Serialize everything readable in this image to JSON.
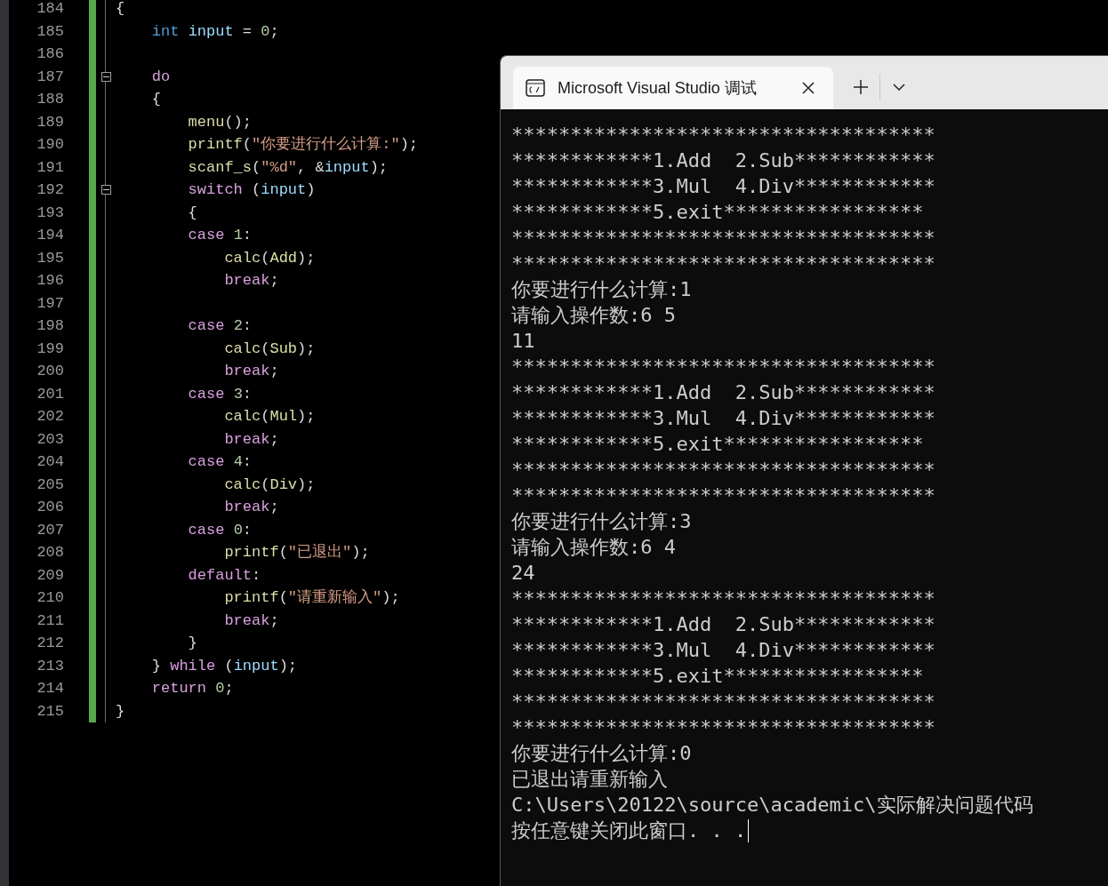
{
  "editor": {
    "lines": [
      {
        "number": "184",
        "tokens": [
          {
            "text": "{",
            "kind": "plain"
          }
        ]
      },
      {
        "number": "185",
        "tokens": [
          {
            "text": "    int ",
            "kind": "type"
          },
          {
            "text": "input",
            "kind": "var"
          },
          {
            "text": " = ",
            "kind": "plain"
          },
          {
            "text": "0",
            "kind": "number"
          },
          {
            "text": ";",
            "kind": "plain"
          }
        ]
      },
      {
        "number": "186"
      },
      {
        "number": "187",
        "fold": {
          "expanded": true
        },
        "tokens": [
          {
            "text": "    do",
            "kind": "keyword"
          }
        ]
      },
      {
        "number": "188",
        "tokens": [
          {
            "text": "    {",
            "kind": "plain"
          }
        ]
      },
      {
        "number": "189",
        "tokens": [
          {
            "text": "        menu",
            "kind": "func"
          },
          {
            "text": "();",
            "kind": "plain"
          }
        ]
      },
      {
        "number": "190",
        "tokens": [
          {
            "text": "        printf",
            "kind": "func"
          },
          {
            "text": "(",
            "kind": "plain"
          },
          {
            "text": "\"你要进行什么计算:\"",
            "kind": "string"
          },
          {
            "text": ");",
            "kind": "plain"
          }
        ]
      },
      {
        "number": "191",
        "tokens": [
          {
            "text": "        scanf_s",
            "kind": "func"
          },
          {
            "text": "(",
            "kind": "plain"
          },
          {
            "text": "\"%d\"",
            "kind": "string"
          },
          {
            "text": ", &",
            "kind": "plain"
          },
          {
            "text": "input",
            "kind": "var"
          },
          {
            "text": ");",
            "kind": "plain"
          }
        ]
      },
      {
        "number": "192",
        "fold": {
          "expanded": true
        },
        "tokens": [
          {
            "text": "        switch",
            "kind": "keyword"
          },
          {
            "text": " (",
            "kind": "plain"
          },
          {
            "text": "input",
            "kind": "var"
          },
          {
            "text": ")",
            "kind": "plain"
          }
        ]
      },
      {
        "number": "193",
        "tokens": [
          {
            "text": "        {",
            "kind": "plain"
          }
        ]
      },
      {
        "number": "194",
        "tokens": [
          {
            "text": "        case ",
            "kind": "keyword"
          },
          {
            "text": "1",
            "kind": "number"
          },
          {
            "text": ":",
            "kind": "plain"
          }
        ]
      },
      {
        "number": "195",
        "tokens": [
          {
            "text": "            calc",
            "kind": "func"
          },
          {
            "text": "(",
            "kind": "plain"
          },
          {
            "text": "Add",
            "kind": "name"
          },
          {
            "text": ");",
            "kind": "plain"
          }
        ]
      },
      {
        "number": "196",
        "tokens": [
          {
            "text": "            break",
            "kind": "keyword"
          },
          {
            "text": ";",
            "kind": "plain"
          }
        ]
      },
      {
        "number": "197"
      },
      {
        "number": "198",
        "tokens": [
          {
            "text": "        case ",
            "kind": "keyword"
          },
          {
            "text": "2",
            "kind": "number"
          },
          {
            "text": ":",
            "kind": "plain"
          }
        ]
      },
      {
        "number": "199",
        "tokens": [
          {
            "text": "            calc",
            "kind": "func"
          },
          {
            "text": "(",
            "kind": "plain"
          },
          {
            "text": "Sub",
            "kind": "name"
          },
          {
            "text": ");",
            "kind": "plain"
          }
        ]
      },
      {
        "number": "200",
        "tokens": [
          {
            "text": "            break",
            "kind": "keyword"
          },
          {
            "text": ";",
            "kind": "plain"
          }
        ]
      },
      {
        "number": "201",
        "tokens": [
          {
            "text": "        case ",
            "kind": "keyword"
          },
          {
            "text": "3",
            "kind": "number"
          },
          {
            "text": ":",
            "kind": "plain"
          }
        ]
      },
      {
        "number": "202",
        "tokens": [
          {
            "text": "            calc",
            "kind": "func"
          },
          {
            "text": "(",
            "kind": "plain"
          },
          {
            "text": "Mul",
            "kind": "name"
          },
          {
            "text": ");",
            "kind": "plain"
          }
        ]
      },
      {
        "number": "203",
        "tokens": [
          {
            "text": "            break",
            "kind": "keyword"
          },
          {
            "text": ";",
            "kind": "plain"
          }
        ]
      },
      {
        "number": "204",
        "tokens": [
          {
            "text": "        case ",
            "kind": "keyword"
          },
          {
            "text": "4",
            "kind": "number"
          },
          {
            "text": ":",
            "kind": "plain"
          }
        ]
      },
      {
        "number": "205",
        "tokens": [
          {
            "text": "            calc",
            "kind": "func"
          },
          {
            "text": "(",
            "kind": "plain"
          },
          {
            "text": "Div",
            "kind": "name"
          },
          {
            "text": ");",
            "kind": "plain"
          }
        ]
      },
      {
        "number": "206",
        "tokens": [
          {
            "text": "            break",
            "kind": "keyword"
          },
          {
            "text": ";",
            "kind": "plain"
          }
        ]
      },
      {
        "number": "207",
        "tokens": [
          {
            "text": "        case ",
            "kind": "keyword"
          },
          {
            "text": "0",
            "kind": "number"
          },
          {
            "text": ":",
            "kind": "plain"
          }
        ]
      },
      {
        "number": "208",
        "tokens": [
          {
            "text": "            printf",
            "kind": "func"
          },
          {
            "text": "(",
            "kind": "plain"
          },
          {
            "text": "\"已退出\"",
            "kind": "string"
          },
          {
            "text": ");",
            "kind": "plain"
          }
        ]
      },
      {
        "number": "209",
        "tokens": [
          {
            "text": "        default",
            "kind": "keyword"
          },
          {
            "text": ":",
            "kind": "plain"
          }
        ]
      },
      {
        "number": "210",
        "tokens": [
          {
            "text": "            printf",
            "kind": "func"
          },
          {
            "text": "(",
            "kind": "plain"
          },
          {
            "text": "\"请重新输入\"",
            "kind": "string"
          },
          {
            "text": ");",
            "kind": "plain"
          }
        ]
      },
      {
        "number": "211",
        "tokens": [
          {
            "text": "            break",
            "kind": "keyword"
          },
          {
            "text": ";",
            "kind": "plain"
          }
        ]
      },
      {
        "number": "212",
        "tokens": [
          {
            "text": "        }",
            "kind": "plain"
          }
        ]
      },
      {
        "number": "213",
        "tokens": [
          {
            "text": "    } ",
            "kind": "plain"
          },
          {
            "text": "while",
            "kind": "keyword"
          },
          {
            "text": " (",
            "kind": "plain"
          },
          {
            "text": "input",
            "kind": "var"
          },
          {
            "text": ");",
            "kind": "plain"
          }
        ]
      },
      {
        "number": "214",
        "tokens": [
          {
            "text": "    return ",
            "kind": "keyword"
          },
          {
            "text": "0",
            "kind": "number"
          },
          {
            "text": ";",
            "kind": "plain"
          }
        ]
      },
      {
        "number": "215",
        "tokens": [
          {
            "text": "}",
            "kind": "plain"
          }
        ]
      }
    ]
  },
  "console": {
    "tabs": [
      {
        "title": "Microsoft Visual Studio 调试",
        "selected": true
      }
    ],
    "output": [
      "************************************",
      "************1.Add  2.Sub************",
      "************3.Mul  4.Div************",
      "************5.exit*****************",
      "************************************",
      "************************************",
      "你要进行什么计算:1",
      "请输入操作数:6 5",
      "11",
      "************************************",
      "************1.Add  2.Sub************",
      "************3.Mul  4.Div************",
      "************5.exit*****************",
      "************************************",
      "************************************",
      "你要进行什么计算:3",
      "请输入操作数:6 4",
      "24",
      "************************************",
      "************1.Add  2.Sub************",
      "************3.Mul  4.Div************",
      "************5.exit*****************",
      "************************************",
      "************************************",
      "你要进行什么计算:0",
      "已退出请重新输入",
      "C:\\Users\\20122\\source\\academic\\实际解决问题代码",
      "按任意键关闭此窗口. . ."
    ]
  }
}
